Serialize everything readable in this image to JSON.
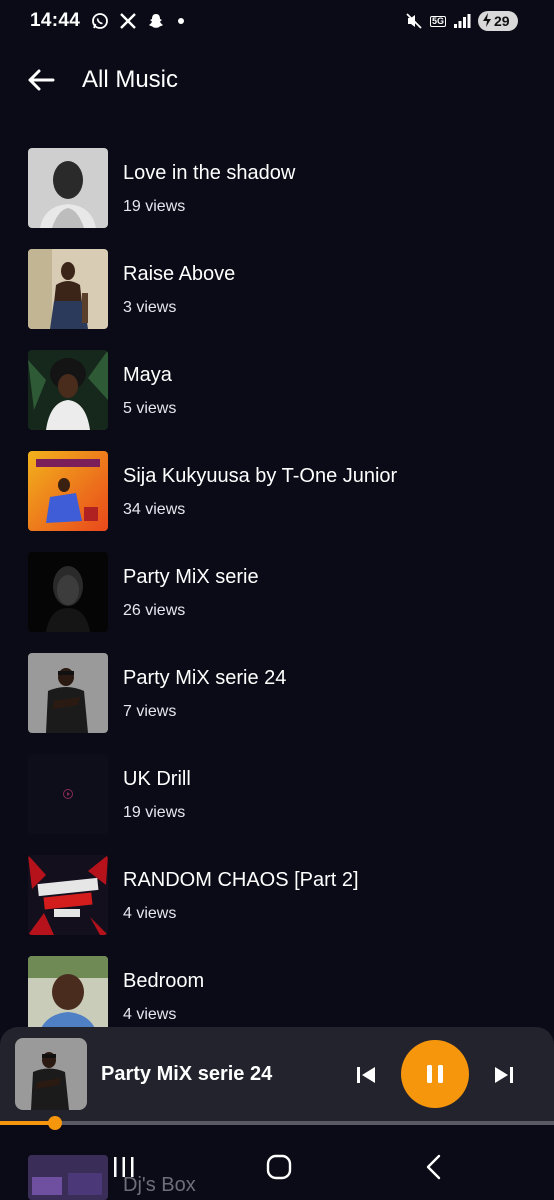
{
  "status_bar": {
    "time": "14:44",
    "icons": [
      "whatsapp-icon",
      "x-icon",
      "snapchat-icon",
      "notification-dot"
    ],
    "right_icons": [
      "mute-icon",
      "5g-icon",
      "signal-icon"
    ],
    "network": "5G",
    "battery": "29"
  },
  "header": {
    "title": "All Music",
    "back_icon": "arrow-left-icon"
  },
  "tracks": [
    {
      "title": "Love in the shadow",
      "views": "19 views"
    },
    {
      "title": "Raise Above",
      "views": "3 views"
    },
    {
      "title": "Maya",
      "views": "5 views"
    },
    {
      "title": "Sija Kukyuusa by T-One Junior",
      "views": "34 views"
    },
    {
      "title": "Party MiX serie",
      "views": "26 views"
    },
    {
      "title": "Party MiX serie 24",
      "views": "7 views"
    },
    {
      "title": "UK Drill",
      "views": "19 views"
    },
    {
      "title": "RANDOM CHAOS [Part 2]",
      "views": "4 views"
    },
    {
      "title": "Bedroom",
      "views": "4 views"
    }
  ],
  "partial_track": {
    "title": "Dj's Box"
  },
  "player": {
    "title": "Party MiX serie 24",
    "progress": 0.1,
    "accent": "#f5960c",
    "prev_icon": "skip-previous-icon",
    "pause_icon": "pause-icon",
    "next_icon": "skip-next-icon"
  },
  "nav": {
    "recents_icon": "recents-icon",
    "home_icon": "home-icon",
    "back_icon": "back-chevron-icon"
  }
}
